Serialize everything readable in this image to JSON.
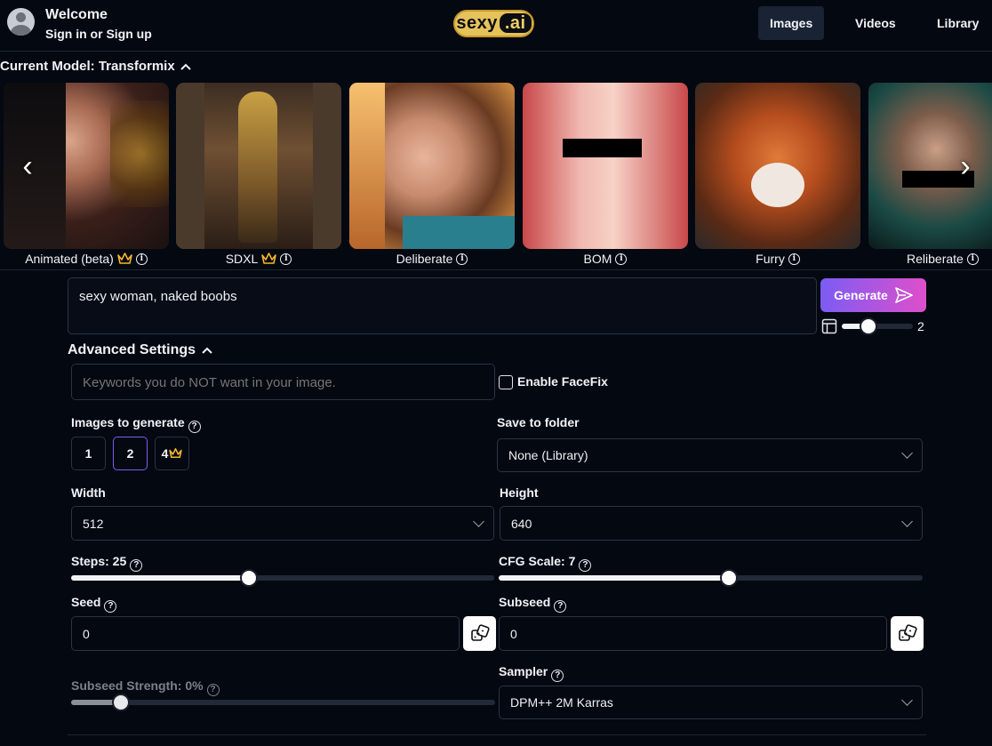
{
  "header": {
    "welcome": "Welcome",
    "signin": "Sign in or Sign up",
    "logo_text": "sexy",
    "logo_suffix": ".ai",
    "nav": [
      "Images",
      "Videos",
      "Library"
    ]
  },
  "model": {
    "current_label": "Current Model: Transformix",
    "cards": [
      {
        "name": "Animated (beta)",
        "premium": true
      },
      {
        "name": "SDXL",
        "premium": true
      },
      {
        "name": "Deliberate",
        "premium": false
      },
      {
        "name": "BOM",
        "premium": false
      },
      {
        "name": "Furry",
        "premium": false
      },
      {
        "name": "Reliberate",
        "premium": false
      }
    ]
  },
  "prompt": {
    "value": "sexy woman, naked boobs",
    "generate_label": "Generate",
    "batch_value": "2"
  },
  "advanced": {
    "title": "Advanced Settings",
    "negative_placeholder": "Keywords you do NOT want in your image.",
    "facefix_label": "Enable FaceFix",
    "images_to_generate_label": "Images to generate",
    "image_counts": [
      "1",
      "2",
      "4"
    ],
    "selected_count": "2",
    "save_folder_label": "Save to folder",
    "save_folder_value": "None (Library)",
    "width_label": "Width",
    "width_value": "512",
    "height_label": "Height",
    "height_value": "640",
    "steps_label": "Steps: 25",
    "steps_value": 25,
    "cfg_label": "CFG Scale: 7",
    "cfg_value": 7,
    "seed_label": "Seed",
    "seed_value": "0",
    "subseed_label": "Subseed",
    "subseed_value": "0",
    "subseed_strength_label": "Subseed Strength: 0%",
    "subseed_strength_value": 0,
    "sampler_label": "Sampler",
    "sampler_value": "DPM++ 2M Karras"
  },
  "colors": {
    "background": "#040811",
    "accent_start": "#7c5cf3",
    "accent_end": "#de4fcb",
    "crown": "#f5b82e"
  }
}
